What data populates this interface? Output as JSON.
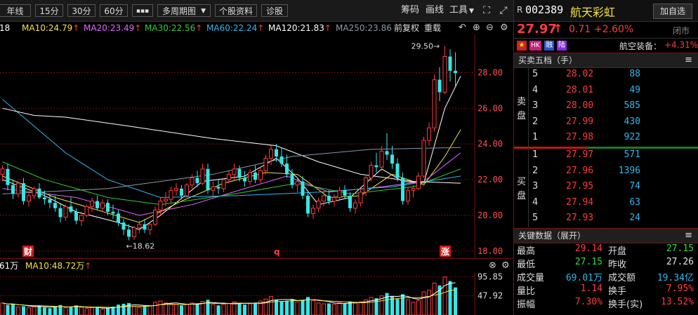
{
  "toolbar": {
    "periods": [
      "年线",
      "15分",
      "30分",
      "60分"
    ],
    "more": "▪▪▪",
    "multi": "多周期图",
    "info": "个股资料",
    "diag": "诊股",
    "chips": "筹码",
    "draw": "画线",
    "tools": "工具"
  },
  "ma": {
    "prefix": "18",
    "ma10": "MA10:24.79",
    "ma20": "MA20:23.49",
    "ma30": "MA30:22.56",
    "ma60": "MA60:22.24",
    "ma120": "MA120:21.83",
    "ma250": "MA250:23.86",
    "adj": "前复权",
    "redraw": "重载",
    "colors": {
      "ma5": "#ffffff",
      "ma10": "#f5e342",
      "ma20": "#e066ff",
      "ma30": "#33cc33",
      "ma60": "#2fb8f0",
      "ma120": "#ffffff",
      "ma250": "#8899aa"
    }
  },
  "chart_data": {
    "type": "candlestick",
    "y_ticks": [
      "28.00",
      "26.00",
      "24.00",
      "22.00",
      "20.00",
      "18.00"
    ],
    "ylim": [
      17.6,
      30.1
    ],
    "annotations": {
      "high": "29.50→",
      "low": "←18.62",
      "markers": [
        "财",
        "q",
        "涨"
      ]
    },
    "candles": [
      [
        22.3,
        22.8,
        21.9,
        22.6
      ],
      [
        22.6,
        22.9,
        21.4,
        21.7
      ],
      [
        21.7,
        22.0,
        20.9,
        21.2
      ],
      [
        21.2,
        21.9,
        21.0,
        21.8
      ],
      [
        21.8,
        22.1,
        20.6,
        20.8
      ],
      [
        20.8,
        21.3,
        20.5,
        21.1
      ],
      [
        21.1,
        21.6,
        20.9,
        21.5
      ],
      [
        21.5,
        21.8,
        20.9,
        21.0
      ],
      [
        21.0,
        21.4,
        20.6,
        20.9
      ],
      [
        20.9,
        21.2,
        20.4,
        20.7
      ],
      [
        20.7,
        21.1,
        20.2,
        20.4
      ],
      [
        20.4,
        20.7,
        19.6,
        19.9
      ],
      [
        19.9,
        20.6,
        19.7,
        20.5
      ],
      [
        20.5,
        21.0,
        20.1,
        20.2
      ],
      [
        20.2,
        20.4,
        19.5,
        19.7
      ],
      [
        19.7,
        20.2,
        19.4,
        20.0
      ],
      [
        20.0,
        20.6,
        19.9,
        20.5
      ],
      [
        20.5,
        21.0,
        20.2,
        20.8
      ],
      [
        20.8,
        21.1,
        20.3,
        20.4
      ],
      [
        20.4,
        20.9,
        20.2,
        20.7
      ],
      [
        20.7,
        20.9,
        20.0,
        20.2
      ],
      [
        20.2,
        20.6,
        19.8,
        20.1
      ],
      [
        20.1,
        20.3,
        19.4,
        19.6
      ],
      [
        19.6,
        19.8,
        18.9,
        19.2
      ],
      [
        19.2,
        19.5,
        18.6,
        18.8
      ],
      [
        18.8,
        19.4,
        18.62,
        19.3
      ],
      [
        19.3,
        19.7,
        19.0,
        19.5
      ],
      [
        19.5,
        19.8,
        19.0,
        19.2
      ],
      [
        19.2,
        19.6,
        18.9,
        19.5
      ],
      [
        19.5,
        20.5,
        19.4,
        20.3
      ],
      [
        20.3,
        21.0,
        20.0,
        20.8
      ],
      [
        20.8,
        21.3,
        20.5,
        20.9
      ],
      [
        20.9,
        21.6,
        20.7,
        21.4
      ],
      [
        21.4,
        21.8,
        21.1,
        21.5
      ],
      [
        21.5,
        21.7,
        20.9,
        21.1
      ],
      [
        21.1,
        21.8,
        21.0,
        21.7
      ],
      [
        21.7,
        22.3,
        21.5,
        22.1
      ],
      [
        22.1,
        22.5,
        21.6,
        21.8
      ],
      [
        21.8,
        22.9,
        21.7,
        22.6
      ],
      [
        22.6,
        22.9,
        21.2,
        21.4
      ],
      [
        21.4,
        21.9,
        21.0,
        21.6
      ],
      [
        21.6,
        22.0,
        21.2,
        21.5
      ],
      [
        21.5,
        22.1,
        21.3,
        22.0
      ],
      [
        22.0,
        22.5,
        21.8,
        22.3
      ],
      [
        22.3,
        22.9,
        22.0,
        22.6
      ],
      [
        22.6,
        22.8,
        21.9,
        22.1
      ],
      [
        22.1,
        22.5,
        21.6,
        21.9
      ],
      [
        21.9,
        22.6,
        21.7,
        22.4
      ],
      [
        22.4,
        22.8,
        21.8,
        22.0
      ],
      [
        22.0,
        22.7,
        21.8,
        22.5
      ],
      [
        22.5,
        23.4,
        22.3,
        23.2
      ],
      [
        23.2,
        23.9,
        22.8,
        23.7
      ],
      [
        23.7,
        24.0,
        23.0,
        23.3
      ],
      [
        23.3,
        23.8,
        22.7,
        22.9
      ],
      [
        22.9,
        23.4,
        22.1,
        22.3
      ],
      [
        22.3,
        22.6,
        21.5,
        21.7
      ],
      [
        21.7,
        22.1,
        21.3,
        21.9
      ],
      [
        21.9,
        22.2,
        20.9,
        21.1
      ],
      [
        21.1,
        21.4,
        19.9,
        20.1
      ],
      [
        20.1,
        20.6,
        19.8,
        20.4
      ],
      [
        20.4,
        21.0,
        20.2,
        20.8
      ],
      [
        20.8,
        21.3,
        20.5,
        21.1
      ],
      [
        21.1,
        21.4,
        20.6,
        20.8
      ],
      [
        20.8,
        21.2,
        20.5,
        21.0
      ],
      [
        21.0,
        21.6,
        20.8,
        21.4
      ],
      [
        21.4,
        21.7,
        20.9,
        21.1
      ],
      [
        21.1,
        21.3,
        20.2,
        20.4
      ],
      [
        20.4,
        20.9,
        20.1,
        20.7
      ],
      [
        20.7,
        21.5,
        20.5,
        21.3
      ],
      [
        21.3,
        22.3,
        21.1,
        22.1
      ],
      [
        22.1,
        23.0,
        21.9,
        22.8
      ],
      [
        22.8,
        23.5,
        22.4,
        22.7
      ],
      [
        22.7,
        23.9,
        22.5,
        23.6
      ],
      [
        23.6,
        24.6,
        23.1,
        23.4
      ],
      [
        23.4,
        23.9,
        22.6,
        22.9
      ],
      [
        22.9,
        23.2,
        21.9,
        22.1
      ],
      [
        22.1,
        22.4,
        20.6,
        20.8
      ],
      [
        20.8,
        21.6,
        20.6,
        21.4
      ],
      [
        21.4,
        21.7,
        21.0,
        21.5
      ],
      [
        21.5,
        22.4,
        21.4,
        22.2
      ],
      [
        22.2,
        24.4,
        22.1,
        24.2
      ],
      [
        24.2,
        25.2,
        23.9,
        24.9
      ],
      [
        24.9,
        27.9,
        24.7,
        27.6
      ],
      [
        27.6,
        28.3,
        26.4,
        26.9
      ],
      [
        26.9,
        29.5,
        26.8,
        28.9
      ],
      [
        28.9,
        29.3,
        27.5,
        28.1
      ],
      [
        28.1,
        29.14,
        27.15,
        27.97
      ]
    ],
    "ma_lines": {
      "ma5": [
        [
          0,
          22.0
        ],
        [
          8,
          21.1
        ],
        [
          14,
          20.2
        ],
        [
          22,
          19.6
        ],
        [
          26,
          19.2
        ],
        [
          30,
          20.0
        ],
        [
          38,
          21.9
        ],
        [
          46,
          22.2
        ],
        [
          52,
          23.2
        ],
        [
          56,
          22.1
        ],
        [
          60,
          20.6
        ],
        [
          66,
          21.0
        ],
        [
          72,
          22.6
        ],
        [
          76,
          21.9
        ],
        [
          80,
          21.8
        ],
        [
          84,
          26.0
        ],
        [
          87,
          27.8
        ]
      ],
      "ma10": [
        [
          0,
          22.2
        ],
        [
          10,
          21.0
        ],
        [
          18,
          20.3
        ],
        [
          26,
          19.6
        ],
        [
          34,
          20.8
        ],
        [
          42,
          21.8
        ],
        [
          50,
          22.4
        ],
        [
          56,
          22.3
        ],
        [
          62,
          21.0
        ],
        [
          68,
          21.1
        ],
        [
          74,
          22.3
        ],
        [
          80,
          21.7
        ],
        [
          84,
          23.3
        ],
        [
          87,
          24.8
        ]
      ],
      "ma20": [
        [
          0,
          21.5
        ],
        [
          14,
          21.0
        ],
        [
          26,
          20.0
        ],
        [
          36,
          20.6
        ],
        [
          46,
          21.5
        ],
        [
          54,
          22.2
        ],
        [
          62,
          21.3
        ],
        [
          72,
          21.6
        ],
        [
          80,
          21.9
        ],
        [
          87,
          23.5
        ]
      ],
      "ma30": [
        [
          0,
          23.0
        ],
        [
          8,
          22.0
        ],
        [
          20,
          21.0
        ],
        [
          30,
          20.6
        ],
        [
          44,
          21.2
        ],
        [
          56,
          21.8
        ],
        [
          66,
          21.2
        ],
        [
          78,
          21.6
        ],
        [
          87,
          22.6
        ]
      ],
      "ma60": [
        [
          0,
          26.5
        ],
        [
          6,
          25.0
        ],
        [
          12,
          23.5
        ],
        [
          20,
          22.0
        ],
        [
          30,
          21.0
        ],
        [
          44,
          21.1
        ],
        [
          60,
          21.3
        ],
        [
          74,
          21.6
        ],
        [
          87,
          22.2
        ]
      ],
      "ma120": [
        [
          0,
          26.0
        ],
        [
          6,
          25.6
        ],
        [
          12,
          25.5
        ],
        [
          24,
          25.0
        ],
        [
          40,
          24.3
        ],
        [
          52,
          23.9
        ],
        [
          60,
          23.0
        ],
        [
          68,
          22.3
        ],
        [
          78,
          21.9
        ],
        [
          87,
          21.8
        ]
      ],
      "ma250": [
        [
          0,
          21.2
        ],
        [
          20,
          21.5
        ],
        [
          40,
          22.3
        ],
        [
          55,
          23.3
        ],
        [
          70,
          23.7
        ],
        [
          87,
          23.8
        ]
      ]
    }
  },
  "volume": {
    "header_prefix": "61万",
    "ma10": "MA10:48.72万",
    "ticks": [
      "95.85",
      "47.92"
    ],
    "values": [
      30,
      25,
      28,
      20,
      22,
      18,
      20,
      24,
      19,
      17,
      22,
      25,
      18,
      20,
      24,
      19,
      16,
      18,
      20,
      15,
      17,
      21,
      26,
      28,
      30,
      22,
      19,
      21,
      23,
      32,
      35,
      30,
      28,
      26,
      24,
      27,
      30,
      28,
      34,
      38,
      26,
      24,
      27,
      29,
      33,
      30,
      26,
      28,
      31,
      35,
      40,
      46,
      38,
      34,
      36,
      40,
      33,
      38,
      45,
      36,
      30,
      28,
      29,
      27,
      31,
      29,
      34,
      30,
      33,
      38,
      44,
      42,
      48,
      55,
      46,
      40,
      52,
      38,
      32,
      36,
      58,
      62,
      80,
      74,
      95,
      85,
      69
    ]
  },
  "quote": {
    "tag": "R",
    "code": "002389",
    "name": "航天彩虹",
    "add_btn": "加自选",
    "price": "27.97",
    "arrow": "↑",
    "change": "0.71",
    "pct": "+2.60%",
    "status": "闭市",
    "badges": [
      "HK",
      "融",
      "陆"
    ],
    "sector": "航空装备：",
    "sector_pct": "+4.31%"
  },
  "orderbook": {
    "title": "买卖五档（手）",
    "sell_label": [
      "卖",
      "盘"
    ],
    "buy_label": [
      "买",
      "盘"
    ],
    "sell": [
      {
        "lv": "5",
        "price": "28.02",
        "vol": "88"
      },
      {
        "lv": "4",
        "price": "28.01",
        "vol": "49"
      },
      {
        "lv": "3",
        "price": "28.00",
        "vol": "585"
      },
      {
        "lv": "2",
        "price": "27.99",
        "vol": "430"
      },
      {
        "lv": "1",
        "price": "27.98",
        "vol": "922"
      }
    ],
    "buy": [
      {
        "lv": "1",
        "price": "27.97",
        "vol": "571"
      },
      {
        "lv": "2",
        "price": "27.96",
        "vol": "1396"
      },
      {
        "lv": "3",
        "price": "27.95",
        "vol": "74"
      },
      {
        "lv": "4",
        "price": "27.94",
        "vol": "63"
      },
      {
        "lv": "5",
        "price": "27.93",
        "vol": "24"
      }
    ]
  },
  "keydata": {
    "title": "关键数据（展开）",
    "rows": [
      {
        "l1": "最高",
        "v1": "29.14",
        "c1": "up",
        "l2": "开盘",
        "v2": "27.15",
        "c2": "dn"
      },
      {
        "l1": "最低",
        "v1": "27.15",
        "c1": "dn",
        "l2": "昨收",
        "v2": "27.26",
        "c2": "wt"
      },
      {
        "l1": "成交量",
        "v1": "69.01万",
        "c1": "cy",
        "l2": "成交额",
        "v2": "19.34亿",
        "c2": "cy"
      },
      {
        "l1": "量比",
        "v1": "1.14",
        "c1": "up",
        "l2": "换手",
        "v2": "7.95%",
        "c2": "up"
      },
      {
        "l1": "振幅",
        "v1": "7.30%",
        "c1": "up",
        "l2": "换手(实)",
        "v2": "13.52%",
        "c2": "up"
      }
    ]
  }
}
